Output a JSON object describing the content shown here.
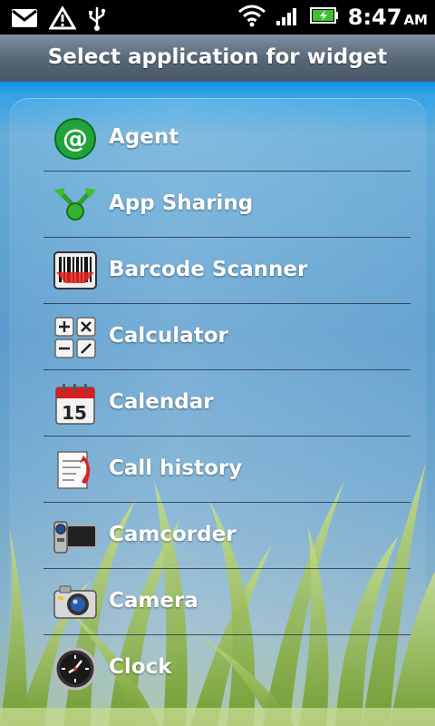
{
  "status_bar": {
    "time": "8:47",
    "ampm": "AM",
    "icons": [
      "mail-icon",
      "warning-icon",
      "usb-icon",
      "wifi-icon",
      "signal-icon",
      "battery-charging-icon"
    ]
  },
  "dialog": {
    "title": "Select application for widget"
  },
  "apps": [
    {
      "label": "Agent",
      "icon": "agent-icon"
    },
    {
      "label": "App Sharing",
      "icon": "app-sharing-icon"
    },
    {
      "label": "Barcode Scanner",
      "icon": "barcode-icon"
    },
    {
      "label": "Calculator",
      "icon": "calculator-icon"
    },
    {
      "label": "Calendar",
      "icon": "calendar-icon"
    },
    {
      "label": "Call history",
      "icon": "call-history-icon"
    },
    {
      "label": "Camcorder",
      "icon": "camcorder-icon"
    },
    {
      "label": "Camera",
      "icon": "camera-icon"
    },
    {
      "label": "Clock",
      "icon": "clock-icon"
    }
  ],
  "calendar_icon_day": "15"
}
